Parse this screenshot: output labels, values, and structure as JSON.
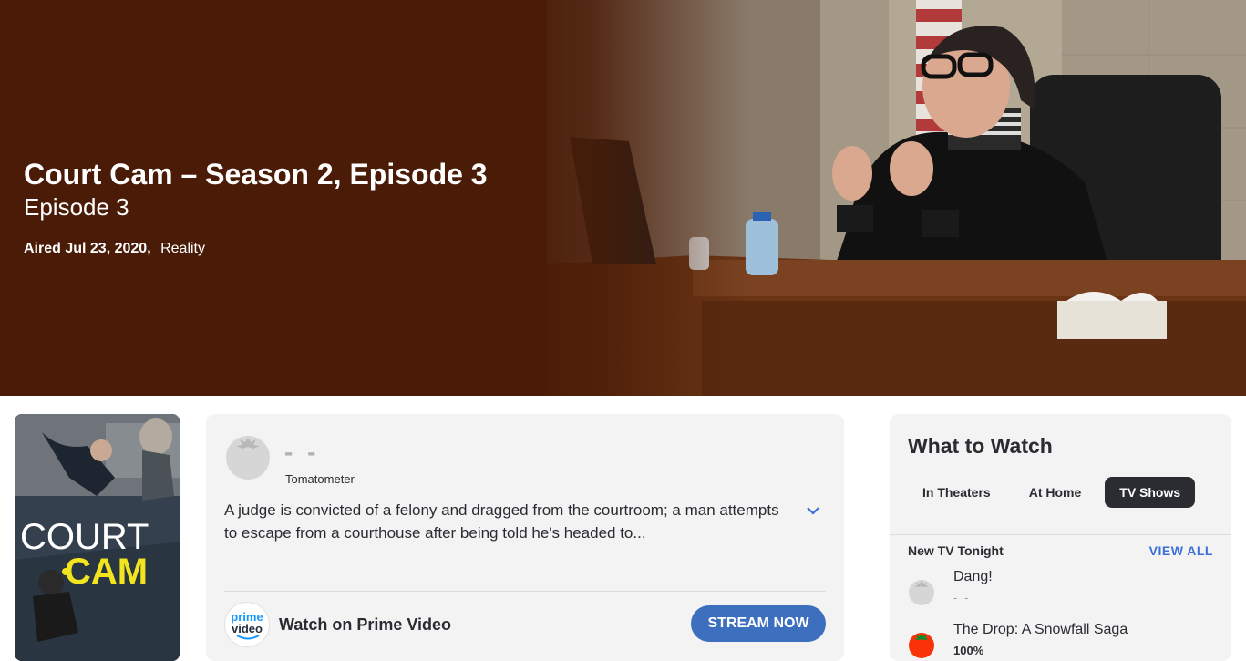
{
  "hero": {
    "title": "Court Cam – Season 2, Episode 3",
    "subtitle": "Episode 3",
    "aired": "Aired Jul 23, 2020,",
    "genre": "Reality"
  },
  "poster": {
    "line1": "COURT",
    "line2": "CAM"
  },
  "score": {
    "value": "- -",
    "label": "Tomatometer"
  },
  "synopsis": "A judge is convicted of a felony and dragged from the courtroom; a man attempts to escape from a courthouse after being told he's headed to...",
  "streaming": {
    "logo_line1": "prime",
    "logo_line2": "video",
    "label": "Watch on Prime Video",
    "button": "STREAM NOW"
  },
  "what_to_watch": {
    "title": "What to Watch",
    "tabs": [
      {
        "label": "In Theaters",
        "active": false
      },
      {
        "label": "At Home",
        "active": false
      },
      {
        "label": "TV Shows",
        "active": true
      }
    ],
    "section_title": "New TV Tonight",
    "view_all": "VIEW ALL",
    "shows": [
      {
        "name": "Dang!",
        "score": "- -",
        "icon": "tomato-empty-icon"
      },
      {
        "name": "The Drop: A Snowfall Saga",
        "score": "100%",
        "icon": "tomato-fresh-icon"
      }
    ]
  },
  "colors": {
    "hero_bg": "#4a1c07",
    "accent_blue": "#3d6fbf",
    "link_blue": "#3b6fdb",
    "tomato_red": "#fa320a"
  }
}
